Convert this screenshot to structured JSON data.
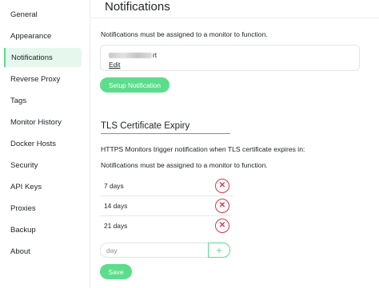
{
  "sidebar": {
    "items": [
      {
        "label": "General"
      },
      {
        "label": "Appearance"
      },
      {
        "label": "Notifications"
      },
      {
        "label": "Reverse Proxy"
      },
      {
        "label": "Tags"
      },
      {
        "label": "Monitor History"
      },
      {
        "label": "Docker Hosts"
      },
      {
        "label": "Security"
      },
      {
        "label": "API Keys"
      },
      {
        "label": "Proxies"
      },
      {
        "label": "Backup"
      },
      {
        "label": "About"
      }
    ],
    "active": "Notifications"
  },
  "page": {
    "title": "Notifications",
    "hint": "Notifications must be assigned to a monitor to function.",
    "notification": {
      "name_suffix": "rt",
      "edit_label": "Edit"
    },
    "setup_button": "Setup Notification"
  },
  "tls": {
    "title": "TLS Certificate Expiry",
    "description": "HTTPS Monitors trigger notification when TLS certificate expires in:",
    "hint": "Notifications must be assigned to a monitor to function.",
    "days": [
      {
        "label": "7 days",
        "remove_icon": "x-icon"
      },
      {
        "label": "14 days",
        "remove_icon": "x-icon"
      },
      {
        "label": "21 days",
        "remove_icon": "x-icon"
      }
    ],
    "input_placeholder": "day",
    "add_icon": "plus-icon",
    "save_button": "Save"
  },
  "colors": {
    "accent": "#5cdd8b",
    "danger": "#dc3545",
    "active_bg": "#e6f8ee"
  }
}
